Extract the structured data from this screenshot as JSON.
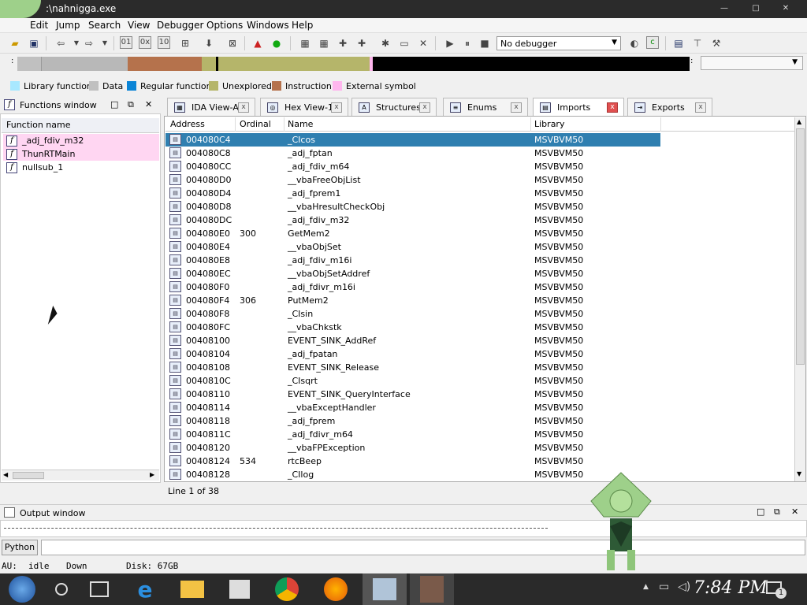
{
  "window": {
    "title": ":\\nahnigga.exe"
  },
  "menu": [
    "Edit",
    "Jump",
    "Search",
    "View",
    "Debugger",
    "Options",
    "Windows",
    "Help"
  ],
  "debugger_select": "No debugger",
  "legend": [
    {
      "label": "Library function",
      "color": "#a8e8ff"
    },
    {
      "label": "Data",
      "color": "#c0c0c0"
    },
    {
      "label": "Regular function",
      "color": "#0a84d6"
    },
    {
      "label": "Unexplored",
      "color": "#b5b56a"
    },
    {
      "label": "Instruction",
      "color": "#b5724c"
    },
    {
      "label": "External symbol",
      "color": "#ffb6ee"
    }
  ],
  "functions_window": {
    "title": "Functions window",
    "column": "Function name",
    "items": [
      "_adj_fdiv_m32",
      "ThunRTMain",
      "nullsub_1"
    ]
  },
  "tabs": [
    {
      "label": "IDA View-A",
      "close": "x"
    },
    {
      "label": "Hex View-1",
      "close": "x"
    },
    {
      "label": "Structures",
      "close": "x"
    },
    {
      "label": "Enums",
      "close": "x"
    },
    {
      "label": "Imports",
      "close": "x"
    },
    {
      "label": "Exports",
      "close": "x"
    }
  ],
  "imports": {
    "columns": [
      "Address",
      "Ordinal",
      "Name",
      "Library"
    ],
    "rows": [
      [
        "004080C4",
        "",
        "_CIcos",
        "MSVBVM50"
      ],
      [
        "004080C8",
        "",
        "_adj_fptan",
        "MSVBVM50"
      ],
      [
        "004080CC",
        "",
        "_adj_fdiv_m64",
        "MSVBVM50"
      ],
      [
        "004080D0",
        "",
        "__vbaFreeObjList",
        "MSVBVM50"
      ],
      [
        "004080D4",
        "",
        "_adj_fprem1",
        "MSVBVM50"
      ],
      [
        "004080D8",
        "",
        "__vbaHresultCheckObj",
        "MSVBVM50"
      ],
      [
        "004080DC",
        "",
        "_adj_fdiv_m32",
        "MSVBVM50"
      ],
      [
        "004080E0",
        "300",
        "GetMem2",
        "MSVBVM50"
      ],
      [
        "004080E4",
        "",
        "__vbaObjSet",
        "MSVBVM50"
      ],
      [
        "004080E8",
        "",
        "_adj_fdiv_m16i",
        "MSVBVM50"
      ],
      [
        "004080EC",
        "",
        "__vbaObjSetAddref",
        "MSVBVM50"
      ],
      [
        "004080F0",
        "",
        "_adj_fdivr_m16i",
        "MSVBVM50"
      ],
      [
        "004080F4",
        "306",
        "PutMem2",
        "MSVBVM50"
      ],
      [
        "004080F8",
        "",
        "_CIsin",
        "MSVBVM50"
      ],
      [
        "004080FC",
        "",
        "__vbaChkstk",
        "MSVBVM50"
      ],
      [
        "00408100",
        "",
        "EVENT_SINK_AddRef",
        "MSVBVM50"
      ],
      [
        "00408104",
        "",
        "_adj_fpatan",
        "MSVBVM50"
      ],
      [
        "00408108",
        "",
        "EVENT_SINK_Release",
        "MSVBVM50"
      ],
      [
        "0040810C",
        "",
        "_CIsqrt",
        "MSVBVM50"
      ],
      [
        "00408110",
        "",
        "EVENT_SINK_QueryInterface",
        "MSVBVM50"
      ],
      [
        "00408114",
        "",
        "__vbaExceptHandler",
        "MSVBVM50"
      ],
      [
        "00408118",
        "",
        "_adj_fprem",
        "MSVBVM50"
      ],
      [
        "0040811C",
        "",
        "_adj_fdivr_m64",
        "MSVBVM50"
      ],
      [
        "00408120",
        "",
        "__vbaFPException",
        "MSVBVM50"
      ],
      [
        "00408124",
        "534",
        "rtcBeep",
        "MSVBVM50"
      ],
      [
        "00408128",
        "",
        "_CIlog",
        "MSVBVM50"
      ]
    ],
    "line_status": "Line 1 of 38"
  },
  "output_window": {
    "title": "Output window"
  },
  "python_button": "Python",
  "status": {
    "au_label": "AU:",
    "au_state": "idle",
    "direction": "Down",
    "disk": "Disk: 67GB"
  },
  "taskbar": {
    "clock": "7:84 PM",
    "notif_count": "1"
  }
}
